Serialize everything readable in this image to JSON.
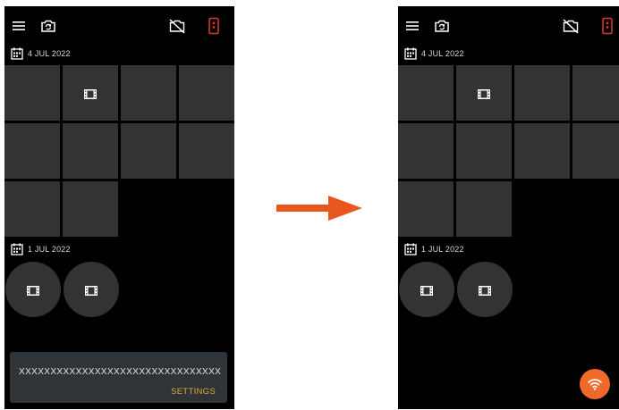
{
  "colors": {
    "phone_bg": "#000000",
    "tile": "#333333",
    "arrow": "#e8561e",
    "fab": "#ef6a2a",
    "snackbar_bg": "#2f3438",
    "snackbar_action": "#e8a33a",
    "status_icon_red": "#e0392b"
  },
  "icons": {
    "menu": "hamburger-menu",
    "switch_camera": "switch-camera",
    "camera_off": "camera-off",
    "phone_status": "phone-with-red-indicator",
    "date": "calendar",
    "video": "film-strip",
    "fab": "wifi",
    "transition": "right-arrow"
  },
  "before": {
    "groups": [
      {
        "date": "4 JUL 2022"
      },
      {
        "date": "1 JUL 2022"
      }
    ],
    "snackbar": {
      "message": "XXXXXXXXXXXXXXXXXXXXXXXXXXXXXXXX",
      "action": "SETTINGS"
    }
  },
  "after": {
    "groups": [
      {
        "date": "4 JUL 2022"
      },
      {
        "date": "1 JUL 2022"
      }
    ]
  }
}
